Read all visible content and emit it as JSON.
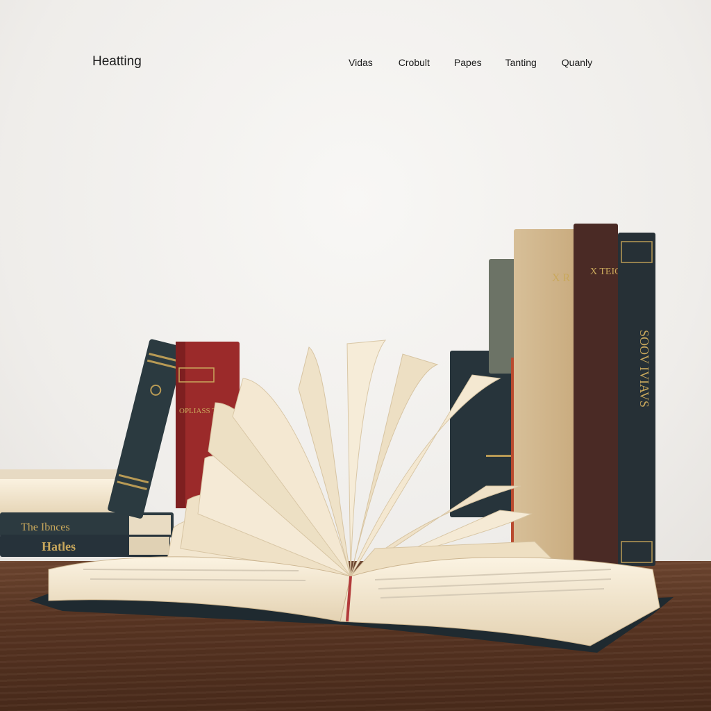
{
  "nav": {
    "brand": "Heatting",
    "links": [
      "Vidas",
      "Crobult",
      "Papes",
      "Tanting",
      "Quanly"
    ]
  },
  "books": {
    "stack_top_title": "The Ibnces",
    "stack_bottom_title": "Hatles",
    "red_spine_title": "OPLIASS TO A LOSAR",
    "right_spine_1": "X R",
    "right_spine_2": "X TEIOAR",
    "right_spine_3": "SOOV IVIAVS"
  },
  "colors": {
    "wall": "#f3f1ee",
    "desk": "#5a3623",
    "pages": "#f2e6cf",
    "navy_binding": "#2a3338",
    "red_binding": "#9b2a2a"
  }
}
